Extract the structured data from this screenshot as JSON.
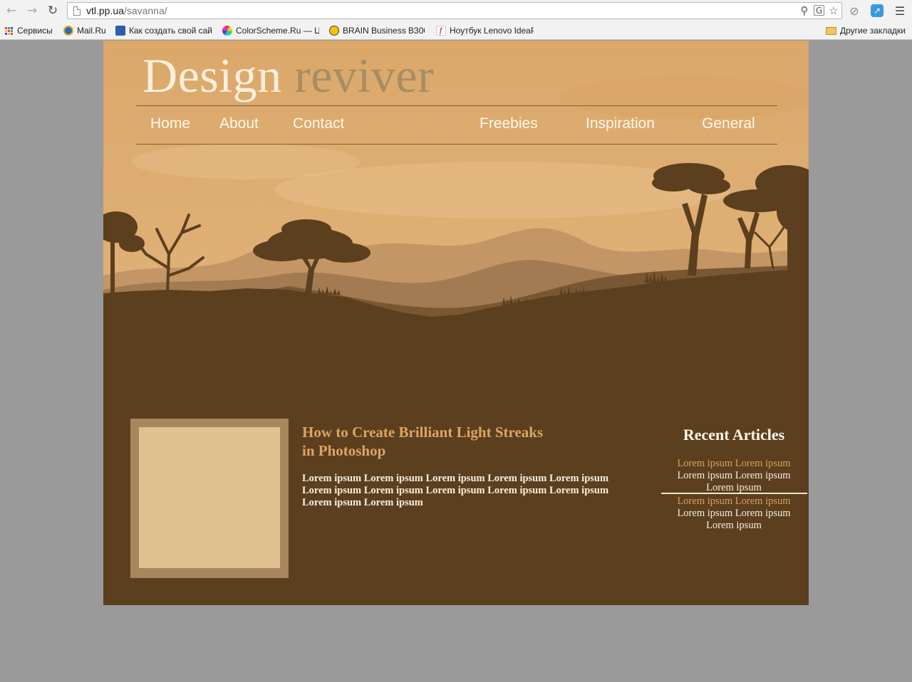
{
  "browser": {
    "url_host": "vtl.pp.ua",
    "url_path": "/savanna/",
    "bookmarks": [
      {
        "label": "Сервисы"
      },
      {
        "label": "Mail.Ru"
      },
      {
        "label": "Как создать свой сай"
      },
      {
        "label": "ColorScheme.Ru — Ц"
      },
      {
        "label": "BRAIN Business B300"
      },
      {
        "label": "Ноутбук Lenovo IdeaP"
      }
    ],
    "other_bookmarks": "Другие закладки"
  },
  "site": {
    "logo_word1": "Design",
    "logo_word2": "reviver",
    "nav": [
      "Home",
      "About",
      "Contact",
      "Freebies",
      "Inspiration",
      "General"
    ],
    "post": {
      "title": "How to Create Brilliant Light Streaks in Photoshop",
      "body": "Lorem ipsum Lorem ipsum Lorem ipsum Lorem ipsum Lorem ipsum Lorem ipsum Lorem ipsum Lorem ipsum Lorem ipsum Lorem ipsum Lorem ipsum Lorem ipsum"
    },
    "recent": {
      "title": "Recent Articles",
      "items": [
        {
          "highlight": "Lorem ipsum Lorem ipsum",
          "text": "Lorem ipsum Lorem ipsum Lorem ipsum"
        },
        {
          "highlight": "Lorem ipsum Lorem ipsum",
          "text": "Lorem ipsum Lorem ipsum Lorem ipsum"
        }
      ]
    }
  },
  "colors": {
    "sky": "#dcaa6e",
    "ground": "#5b3f1e",
    "post_title": "#dda463",
    "thumb_frame": "#a8865e",
    "thumb_inner": "#dfc28f"
  }
}
